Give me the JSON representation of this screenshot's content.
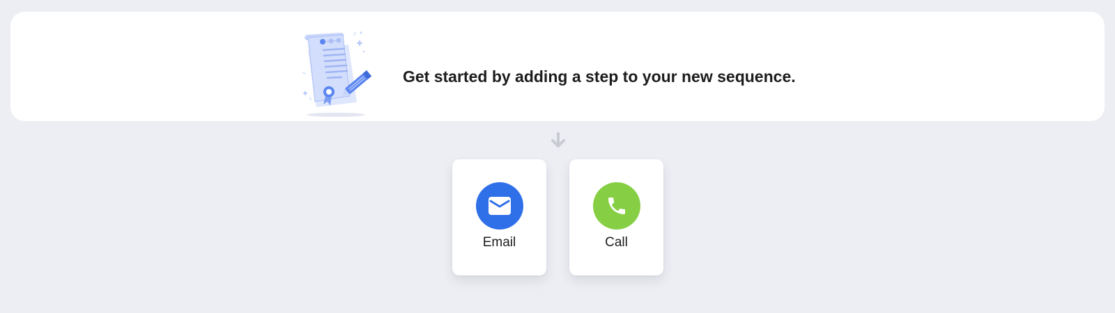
{
  "banner": {
    "message": "Get started by adding a step to your new sequence."
  },
  "steps": [
    {
      "label": "Email",
      "icon": "envelope-icon",
      "color": "#2f6fe8"
    },
    {
      "label": "Call",
      "icon": "phone-icon",
      "color": "#86cf45"
    }
  ],
  "colors": {
    "background": "#edeef3",
    "card": "#ffffff",
    "arrow": "#c9cbd3",
    "illustration_accent": "#5b86f0"
  }
}
